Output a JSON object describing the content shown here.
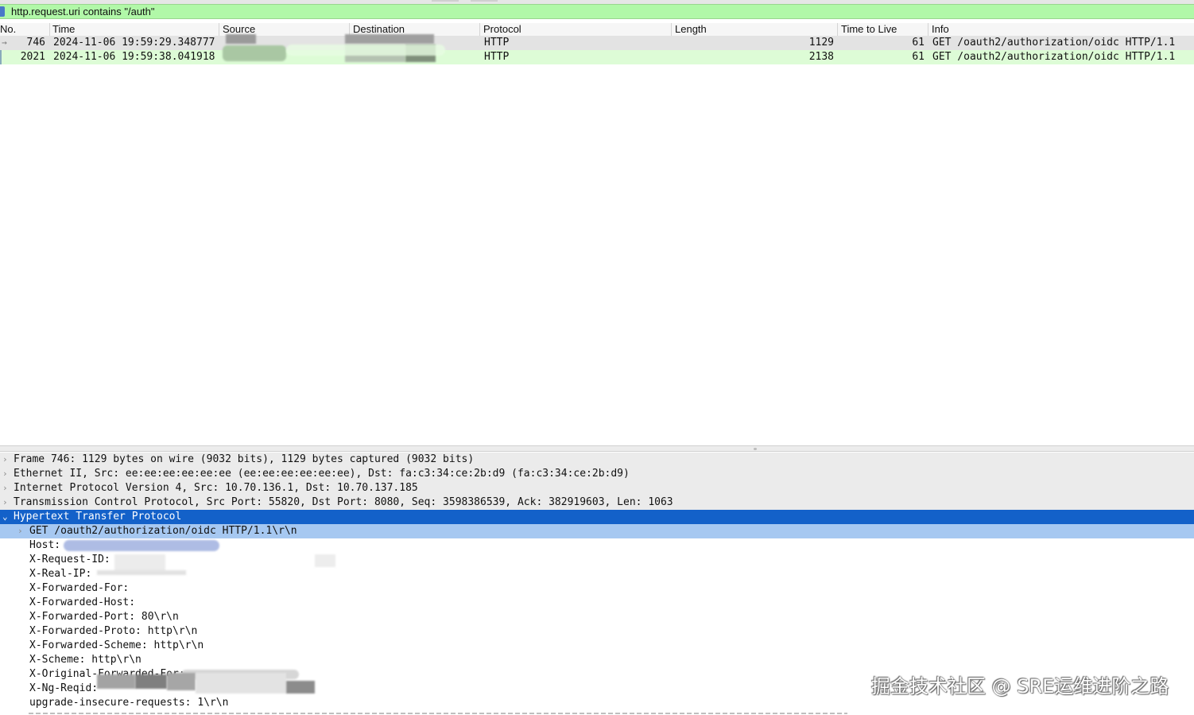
{
  "display_filter": {
    "value": "http.request.uri contains \"/auth\""
  },
  "packet_list": {
    "columns": [
      "No.",
      "Time",
      "Source",
      "Destination",
      "Protocol",
      "Length",
      "Time to Live",
      "Info"
    ],
    "rows": [
      {
        "no": "746",
        "time": "2024-11-06 19:59:29.348777",
        "source": "",
        "destination": "",
        "protocol": "HTTP",
        "length": "1129",
        "ttl": "61",
        "info": "GET /oauth2/authorization/oidc HTTP/1.1",
        "selected": true
      },
      {
        "no": "2021",
        "time": "2024-11-06 19:59:38.041918",
        "source": "",
        "destination": "",
        "protocol": "HTTP",
        "length": "2138",
        "ttl": "61",
        "info": "GET /oauth2/authorization/oidc HTTP/1.1",
        "selected": false
      }
    ]
  },
  "packet_details": {
    "layers": [
      "Frame 746: 1129 bytes on wire (9032 bits), 1129 bytes captured (9032 bits)",
      "Ethernet II, Src: ee:ee:ee:ee:ee:ee (ee:ee:ee:ee:ee:ee), Dst: fa:c3:34:ce:2b:d9 (fa:c3:34:ce:2b:d9)",
      "Internet Protocol Version 4, Src: 10.70.136.1, Dst: 10.70.137.185",
      "Transmission Control Protocol, Src Port: 55820, Dst Port: 8080, Seq: 3598386539, Ack: 382919603, Len: 1063",
      "Hypertext Transfer Protocol"
    ],
    "http_request_line": "GET /oauth2/authorization/oidc HTTP/1.1\\r\\n",
    "http_fields": [
      "Host:",
      "X-Request-ID:",
      "X-Real-IP:",
      "X-Forwarded-For:",
      "X-Forwarded-Host:",
      "X-Forwarded-Port: 80\\r\\n",
      "X-Forwarded-Proto: http\\r\\n",
      "X-Forwarded-Scheme: http\\r\\n",
      "X-Scheme: http\\r\\n",
      "X-Original-Forwarded-For:",
      "X-Ng-Reqid:",
      "upgrade-insecure-requests: 1\\r\\n"
    ]
  },
  "watermark": "掘金技术社区 @ SRE运维进阶之路",
  "icons": {
    "collapsed": "chevron-right-icon",
    "expanded": "chevron-down-icon",
    "selected_packet_marker": "arrow-right-icon"
  },
  "colors": {
    "filter_valid": "#b1f8a8",
    "selected_layer": "#1361c9",
    "selected_child": "#a6c8f1",
    "http_row": "#ddfcd6"
  }
}
